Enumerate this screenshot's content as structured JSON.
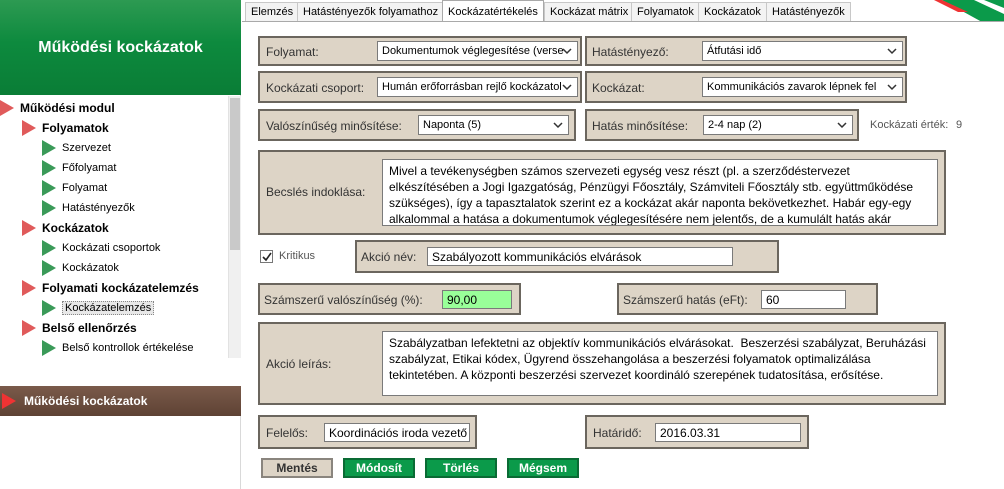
{
  "sidebar": {
    "title": "Működési kockázatok",
    "tree": [
      {
        "label": "Működési modul",
        "level": 0,
        "icon": "red-triangle-icon"
      },
      {
        "label": "Folyamatok",
        "level": 1,
        "icon": "red-triangle-icon"
      },
      {
        "label": "Szervezet",
        "level": 2,
        "icon": "green-triangle-icon"
      },
      {
        "label": "Főfolyamat",
        "level": 2,
        "icon": "green-triangle-icon"
      },
      {
        "label": "Folyamat",
        "level": 2,
        "icon": "green-triangle-icon"
      },
      {
        "label": "Hatástényezők",
        "level": 2,
        "icon": "green-triangle-icon"
      },
      {
        "label": "Kockázatok",
        "level": 1,
        "icon": "red-triangle-icon"
      },
      {
        "label": "Kockázati csoportok",
        "level": 2,
        "icon": "green-triangle-icon"
      },
      {
        "label": "Kockázatok",
        "level": 2,
        "icon": "green-triangle-icon"
      },
      {
        "label": "Folyamati kockázatelemzés",
        "level": 1,
        "icon": "red-triangle-icon"
      },
      {
        "label": "Kockázatelemzés",
        "level": 2,
        "icon": "green-triangle-icon",
        "selected": true
      },
      {
        "label": "Belső ellenőrzés",
        "level": 1,
        "icon": "red-triangle-icon"
      },
      {
        "label": "Belső kontrollok értékelése",
        "level": 2,
        "icon": "green-triangle-icon"
      }
    ],
    "footer": "Működési kockázatok"
  },
  "tabs": [
    {
      "label": "Elemzés"
    },
    {
      "label": "Hatástényezők folyamathoz"
    },
    {
      "label": "Kockázatértékelés",
      "active": true
    },
    {
      "label": "Kockázat mátrix"
    },
    {
      "label": "Folyamatok"
    },
    {
      "label": "Kockázatok"
    },
    {
      "label": "Hatástényezők"
    }
  ],
  "form": {
    "folyamat_label": "Folyamat:",
    "folyamat_value": "Dokumentumok véglegesítése (verse",
    "hatastenyezo_label": "Hatástényező:",
    "hatastenyezo_value": "Átfutási idő",
    "kockazati_csoport_label": "Kockázati csoport:",
    "kockazati_csoport_value": "Humán erőforrásban rejlő kockázatol",
    "kockazat_label": "Kockázat:",
    "kockazat_value": "Kommunikációs zavarok lépnek fel",
    "valoszinuseg_label": "Valószínűség minősítése:",
    "valoszinuseg_value": "Naponta (5)",
    "hatas_label": "Hatás minősítése:",
    "hatas_value": "2-4 nap (2)",
    "kockazati_ertek_label": "Kockázati érték:",
    "kockazati_ertek_value": "9",
    "becsles_label": "Becslés indoklása:",
    "becsles_text": "Mivel a tevékenységben számos szervezeti egység vesz részt (pl. a szerződéstervezet\nelkészítésében a Jogi Igazgatóság, Pénzügyi Főosztály, Számviteli Főosztály stb. együttműködése\nszükséges), így a tapasztalatok szerint ez a kockázat akár naponta bekövetkezhet. Habár egy-egy\nalkalommal a hatása a dokumentumok véglegesítésére nem jelentős, de a kumulált hatás akár",
    "kritikus_label": "Kritikus",
    "kritikus_checked": true,
    "akcio_nev_label": "Akció név:",
    "akcio_nev_value": "Szabályozott kommunikációs elvárások",
    "szamszeru_valoszinuseg_label": "Számszerű valószínűség (%):",
    "szamszeru_valoszinuseg_value": "90,00",
    "szamszeru_hatas_label": "Számszerű hatás (eFt):",
    "szamszeru_hatas_value": "60",
    "akcio_leiras_label": "Akció leírás:",
    "akcio_leiras_text": "Szabályzatban lefektetni az objektív kommunikációs elvárásokat.  Beszerzési szabályzat, Beruházási\nszabályzat, Etikai kódex, Ügyrend összehangolása a beszerzési folyamatok optimalizálása\ntekintetében. A központi beszerzési szervezet koordináló szerepének tudatosítása, erősítése.",
    "felelos_label": "Felelős:",
    "felelos_value": "Koordinációs iroda vezető",
    "hatarido_label": "Határidő:",
    "hatarido_value": "2016.03.31"
  },
  "buttons": {
    "save": "Mentés",
    "modify": "Módosít",
    "delete": "Törlés",
    "cancel": "Mégsem"
  },
  "colors": {
    "brand_green": "#0b9a4a",
    "panel_bg": "#ddd4c6",
    "highlight_value_bg": "#99ff99",
    "sidebar_footer": "#5e4234"
  }
}
